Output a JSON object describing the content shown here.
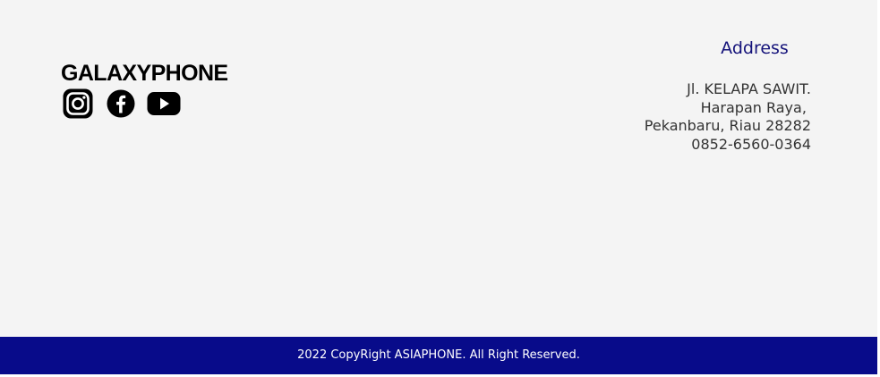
{
  "footer": {
    "brand": "GALAXYPHONE",
    "social_icons": [
      "instagram-icon",
      "facebook-icon",
      "youtube-icon"
    ],
    "address": {
      "title": "Address",
      "lines": [
        "Jl. KELAPA SAWIT.",
        "Harapan Raya, ",
        "Pekanbaru, Riau 28282",
        "0852-6560-0364"
      ]
    }
  },
  "copyright": {
    "text": "2022 CopyRight ASIAPHONE. All Right Reserved."
  },
  "colors": {
    "footer_background": "#f4f4f4",
    "copyright_bar": "#080b8a",
    "address_title": "#14127a",
    "address_text": "#333333"
  }
}
